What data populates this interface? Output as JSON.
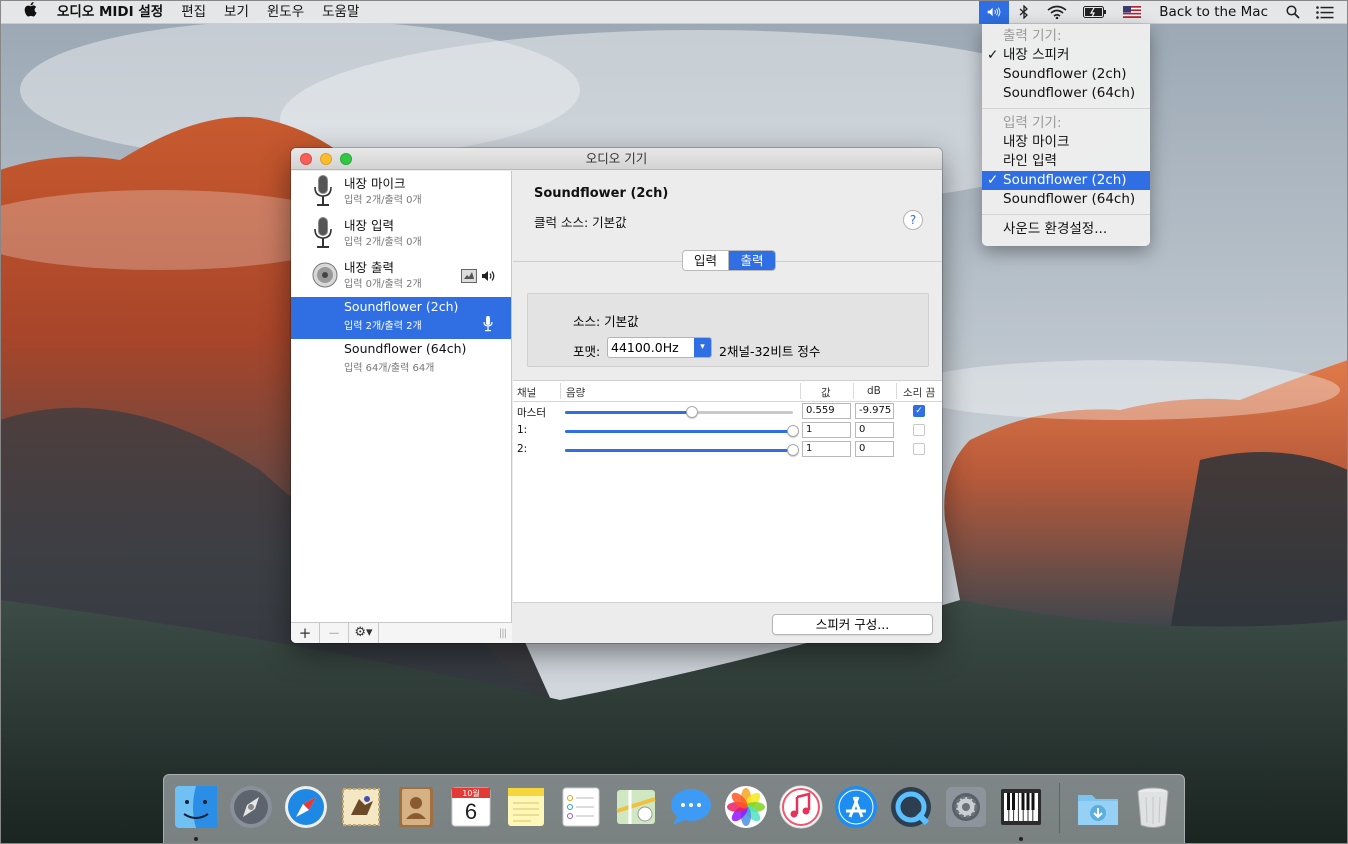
{
  "menubar": {
    "apple": "",
    "items": [
      "오디오 MIDI 설정",
      "편집",
      "보기",
      "윈도우",
      "도움말"
    ],
    "back_to_mac": "Back to the Mac"
  },
  "volume_menu": {
    "output_header": "출력 기기:",
    "outputs": [
      "내장 스피커",
      "Soundflower (2ch)",
      "Soundflower (64ch)"
    ],
    "selected_output": 0,
    "input_header": "입력 기기:",
    "inputs": [
      "내장 마이크",
      "라인 입력",
      "Soundflower (2ch)",
      "Soundflower (64ch)"
    ],
    "selected_input": 2,
    "check": "✓",
    "prefs": "사운드 환경설정..."
  },
  "window": {
    "title": "오디오 기기",
    "devices": [
      {
        "name": "내장 마이크",
        "sub": "입력 2개/출력 0개"
      },
      {
        "name": "내장 입력",
        "sub": "입력 2개/출력 0개"
      },
      {
        "name": "내장 출력",
        "sub": "입력 0개/출력 2개"
      },
      {
        "name": "Soundflower (2ch)",
        "sub": "입력 2개/출력 2개"
      },
      {
        "name": "Soundflower (64ch)",
        "sub": "입력 64개/출력 64개"
      }
    ],
    "bottom": {
      "add": "+",
      "remove": "−",
      "gear": "⚙▾",
      "grip": "|||"
    },
    "device_title": "Soundflower (2ch)",
    "clock_source": "클럭 소스:  기본값",
    "help": "?",
    "tabs": [
      "입력",
      "출력"
    ],
    "active_tab": 1,
    "source": "소스:  기본값",
    "format_label": "포맷:",
    "format_value": "44100.0Hz",
    "format_bits": "2채널-32비트 정수",
    "table": {
      "headers": [
        "채널",
        "음량",
        "값",
        "dB",
        "소리 끔"
      ],
      "rows": [
        {
          "label": "마스터",
          "level": 0.559,
          "value": "0.559",
          "db": "-9.975",
          "muted": true
        },
        {
          "label": "1:",
          "level": 1.0,
          "value": "1",
          "db": "0",
          "muted": false
        },
        {
          "label": "2:",
          "level": 1.0,
          "value": "1",
          "db": "0",
          "muted": false
        }
      ]
    },
    "speaker_button": "스피커 구성..."
  },
  "dock": {
    "apps": [
      "finder-icon",
      "launchpad-icon",
      "safari-icon",
      "mail-icon",
      "contacts-icon",
      "calendar-icon",
      "notes-icon",
      "reminders-icon",
      "maps-icon",
      "messages-icon",
      "photos-icon",
      "itunes-icon",
      "app-store-icon",
      "quicktime-icon",
      "system-preferences-icon",
      "audio-midi-setup-icon",
      "downloads-icon",
      "trash-icon"
    ],
    "calendar_month": "10월",
    "calendar_day": "6"
  }
}
